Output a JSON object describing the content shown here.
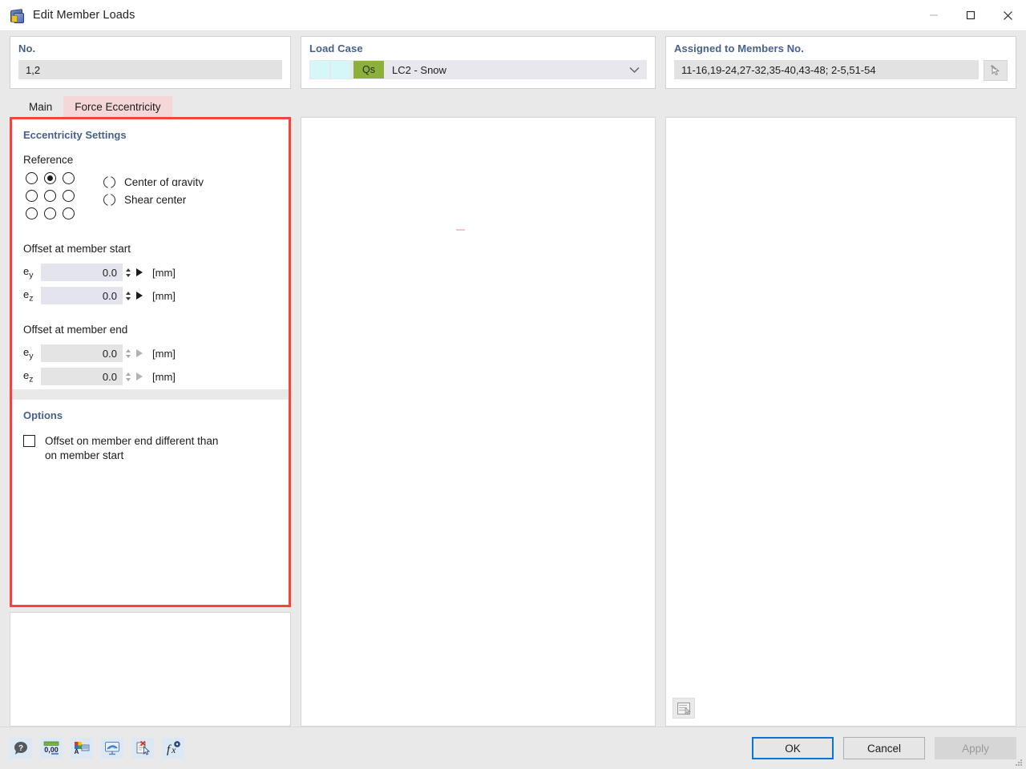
{
  "window": {
    "title": "Edit Member Loads",
    "icon": "member-loads-icon",
    "minimize_label": "—",
    "maximize_label": "□",
    "close_label": "✕"
  },
  "header": {
    "no": {
      "label": "No.",
      "value": "1,2"
    },
    "load_case": {
      "label": "Load Case",
      "tag": "Qs",
      "value": "LC2 - Snow",
      "tag_color": "#8cb03c",
      "swatch_color": "#d6f7f7"
    },
    "assigned": {
      "label": "Assigned to Members No.",
      "value": "11-16,19-24,27-32,35-40,43-48; 2-5,51-54",
      "pick_icon": "select-cursor-icon"
    }
  },
  "tabs": [
    {
      "label": "Main",
      "active": false
    },
    {
      "label": "Force Eccentricity",
      "active": true
    }
  ],
  "eccentricity": {
    "section_title": "Eccentricity Settings",
    "reference_label": "Reference",
    "grid_selected_index": 1,
    "grid_cells": [
      "top-left",
      "top-center",
      "top-right",
      "middle-left",
      "middle-center",
      "middle-right",
      "bottom-left",
      "bottom-center",
      "bottom-right"
    ],
    "reference_options": [
      {
        "label": "Center of gravity",
        "selected": false
      },
      {
        "label": "Shear center",
        "selected": false
      }
    ],
    "offset_start": {
      "title": "Offset at member start",
      "rows": [
        {
          "symbol": "e",
          "sub": "y",
          "value": "0.0",
          "unit": "[mm]",
          "enabled": true
        },
        {
          "symbol": "e",
          "sub": "z",
          "value": "0.0",
          "unit": "[mm]",
          "enabled": true
        }
      ]
    },
    "offset_end": {
      "title": "Offset at member end",
      "rows": [
        {
          "symbol": "e",
          "sub": "y",
          "value": "0.0",
          "unit": "[mm]",
          "enabled": false
        },
        {
          "symbol": "e",
          "sub": "z",
          "value": "0.0",
          "unit": "[mm]",
          "enabled": false
        }
      ]
    }
  },
  "options": {
    "section_title": "Options",
    "checkbox": {
      "label": "Offset on member end different than on member start",
      "checked": false
    }
  },
  "panels": {
    "middle": {
      "content": ""
    },
    "right": {
      "content": "",
      "tool_icon": "copy-to-clipboard-icon"
    }
  },
  "footer": {
    "tools": [
      {
        "name": "help-icon",
        "title": "?"
      },
      {
        "name": "units-icon",
        "title": "0,00"
      },
      {
        "name": "display-properties-icon",
        "title": ""
      },
      {
        "name": "visibility-icon",
        "title": ""
      },
      {
        "name": "delete-load-icon",
        "title": ""
      },
      {
        "name": "formula-icon",
        "title": "fx"
      }
    ],
    "buttons": {
      "ok": "OK",
      "cancel": "Cancel",
      "apply": "Apply"
    },
    "apply_enabled": false
  },
  "colors": {
    "accent_heading": "#46618c",
    "highlight_border": "#f4443c",
    "tab_active_bg": "#f6d7d7",
    "focus_blue": "#0a74d2",
    "window_bg": "#e9e9e9"
  }
}
